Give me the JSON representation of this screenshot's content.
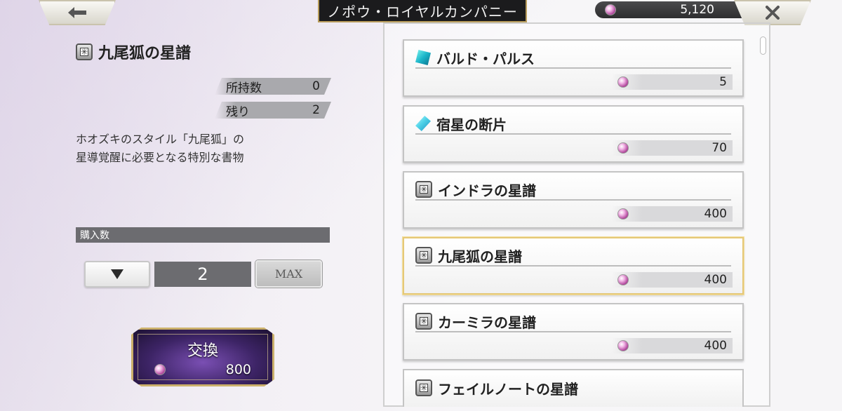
{
  "header": {
    "title": "ノポウ・ロイヤルカンパニー",
    "currency_amount": "5,120"
  },
  "icons": {
    "back": "back-arrow-icon",
    "close": "close-x-icon",
    "currency": "pink-gem-icon"
  },
  "detail": {
    "item_name": "九尾狐の星譜",
    "owned_label": "所持数",
    "owned_value": "0",
    "remaining_label": "残り",
    "remaining_value": "2",
    "description_line1": "ホオズキのスタイル「九尾狐」の",
    "description_line2": "星導覚醒に必要となる特別な書物"
  },
  "purchase": {
    "qty_label": "購入数",
    "qty_value": "2",
    "max_label": "MAX",
    "exchange_label": "交換",
    "exchange_cost": "800"
  },
  "shop_items": [
    {
      "name": "バルド・パルス",
      "price": "5",
      "icon": "blue-card-icon"
    },
    {
      "name": "宿星の断片",
      "price": "70",
      "icon": "crystal-shard-icon"
    },
    {
      "name": "インドラの星譜",
      "price": "400",
      "icon": "scroll-book-icon"
    },
    {
      "name": "九尾狐の星譜",
      "price": "400",
      "icon": "scroll-book-icon",
      "selected": true
    },
    {
      "name": "カーミラの星譜",
      "price": "400",
      "icon": "scroll-book-icon"
    },
    {
      "name": "フェイルノートの星譜",
      "price": "",
      "icon": "scroll-book-icon"
    }
  ],
  "colors": {
    "selected_border": "#e5c878",
    "title_bar_bg": "#1b1b1d",
    "exchange_bg": "#3d2466"
  }
}
